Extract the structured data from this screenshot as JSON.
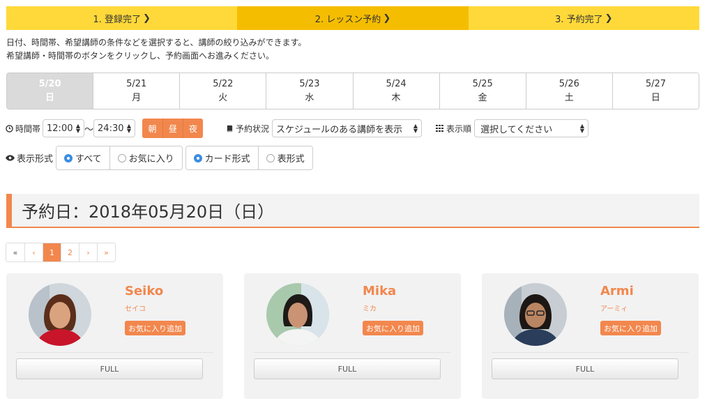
{
  "steps": [
    {
      "label": "1. 登録完了",
      "active": false
    },
    {
      "label": "2. レッスン予約",
      "active": true
    },
    {
      "label": "3. 予約完了",
      "active": false
    }
  ],
  "intro": {
    "line1": "日付、時間帯、希望講師の条件などを選択すると、講師の絞り込みができます。",
    "line2": "希望講師・時間帯のボタンをクリックし、予約画面へお進みください。"
  },
  "days": [
    {
      "date": "5/20",
      "wd": "日"
    },
    {
      "date": "5/21",
      "wd": "月"
    },
    {
      "date": "5/22",
      "wd": "火"
    },
    {
      "date": "5/23",
      "wd": "水"
    },
    {
      "date": "5/24",
      "wd": "木"
    },
    {
      "date": "5/25",
      "wd": "金"
    },
    {
      "date": "5/26",
      "wd": "土"
    },
    {
      "date": "5/27",
      "wd": "日"
    }
  ],
  "filters": {
    "time_label": "時間帯",
    "time_from": "12:00",
    "tilde": "〜",
    "time_to": "24:30",
    "tod": [
      "朝",
      "昼",
      "夜"
    ],
    "status_label": "予約状況",
    "status_value": "スケジュールのある講師を表示",
    "order_label": "表示順",
    "order_value": "選択してください"
  },
  "view": {
    "label": "表示形式",
    "all": "すべて",
    "fav": "お気に入り",
    "card": "カード形式",
    "table": "表形式"
  },
  "heading": "予約日：2018年05月20日（日）",
  "pager": [
    "«",
    "‹",
    "1",
    "2",
    "›",
    "»"
  ],
  "teachers": [
    {
      "name": "Seiko",
      "kana": "セイコ",
      "fav": "お気に入り追加",
      "status": "FULL"
    },
    {
      "name": "Mika",
      "kana": "ミカ",
      "fav": "お気に入り追加",
      "status": "FULL"
    },
    {
      "name": "Armi",
      "kana": "アーミィ",
      "fav": "お気に入り追加",
      "status": "FULL"
    }
  ],
  "icons": {
    "chevron": "chevron-right-icon",
    "clock": "clock-icon",
    "book": "book-icon",
    "grid": "grid-icon",
    "eye": "eye-icon"
  },
  "colors": {
    "accent": "#f2874d",
    "step_bg": "#ffd93a",
    "step_active": "#f5bd00",
    "radio": "#3b8de0"
  }
}
